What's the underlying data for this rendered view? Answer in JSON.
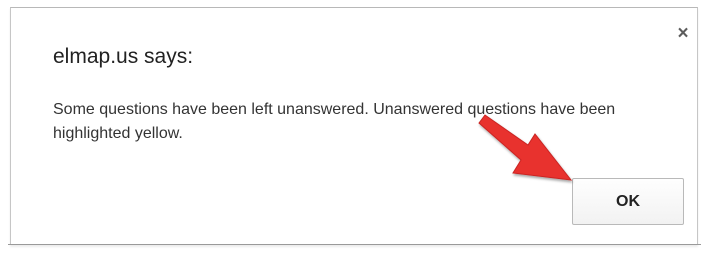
{
  "dialog": {
    "title": "elmap.us says:",
    "message": "Some questions have been left unanswered. Unanswered questions have been highlighted yellow.",
    "ok_label": "OK",
    "close_icon": "close-icon"
  },
  "annotation": {
    "arrow_icon": "red-arrow-icon",
    "arrow_color": "#e8302f"
  }
}
